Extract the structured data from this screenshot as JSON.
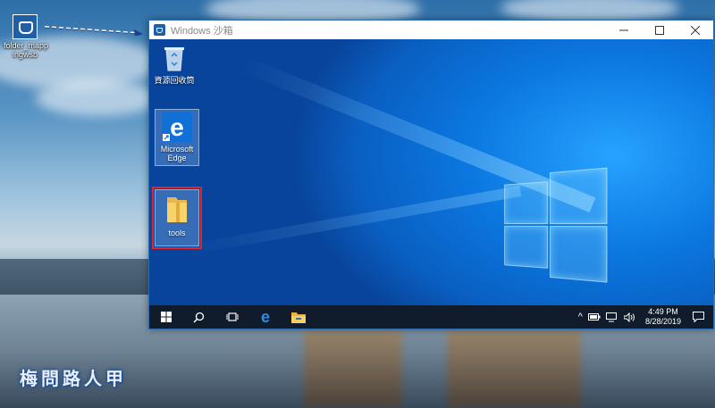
{
  "desktop": {
    "icon_label": "folder_mapp\ningwsb",
    "watermark": "梅問路人甲"
  },
  "window": {
    "title": "Windows 沙箱",
    "controls": [
      "minimize",
      "maximize",
      "close"
    ]
  },
  "sandbox_desktop": {
    "icons": [
      {
        "label": "資源回收筒",
        "icon": "recycle-bin-icon"
      },
      {
        "label": "Microsoft\nEdge",
        "icon": "edge-icon"
      },
      {
        "label": "tools",
        "icon": "folder-icon"
      }
    ]
  },
  "taskbar": {
    "time": "4:49 PM",
    "date": "8/28/2019",
    "tray_caret": "^"
  },
  "colors": {
    "highlight": "#e0252c",
    "desktop_blue": "#0b78e0",
    "taskbar": "#101c2b"
  }
}
